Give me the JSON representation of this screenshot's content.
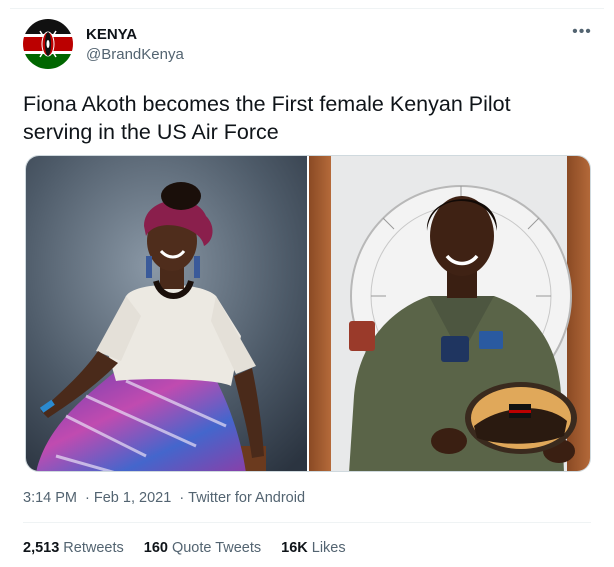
{
  "author": {
    "name": "KENYA",
    "handle": "@BrandKenya",
    "avatar_icon": "kenya-flag-icon"
  },
  "tweet": {
    "text": "Fiona Akoth becomes the First female Kenyan Pilot serving in the US Air Force"
  },
  "media": {
    "photos": [
      {
        "icon": "portrait-photo-civilian"
      },
      {
        "icon": "portrait-photo-uniform"
      }
    ]
  },
  "meta": {
    "time": "3:14 PM",
    "date": "Feb 1, 2021",
    "source": "Twitter for Android",
    "separator": "·"
  },
  "stats": {
    "retweets_count": "2,513",
    "retweets_label": "Retweets",
    "quotes_count": "160",
    "quotes_label": "Quote Tweets",
    "likes_count": "16K",
    "likes_label": "Likes"
  },
  "colors": {
    "text_primary": "#0f1419",
    "text_secondary": "#536471",
    "divider": "#eff3f4"
  }
}
